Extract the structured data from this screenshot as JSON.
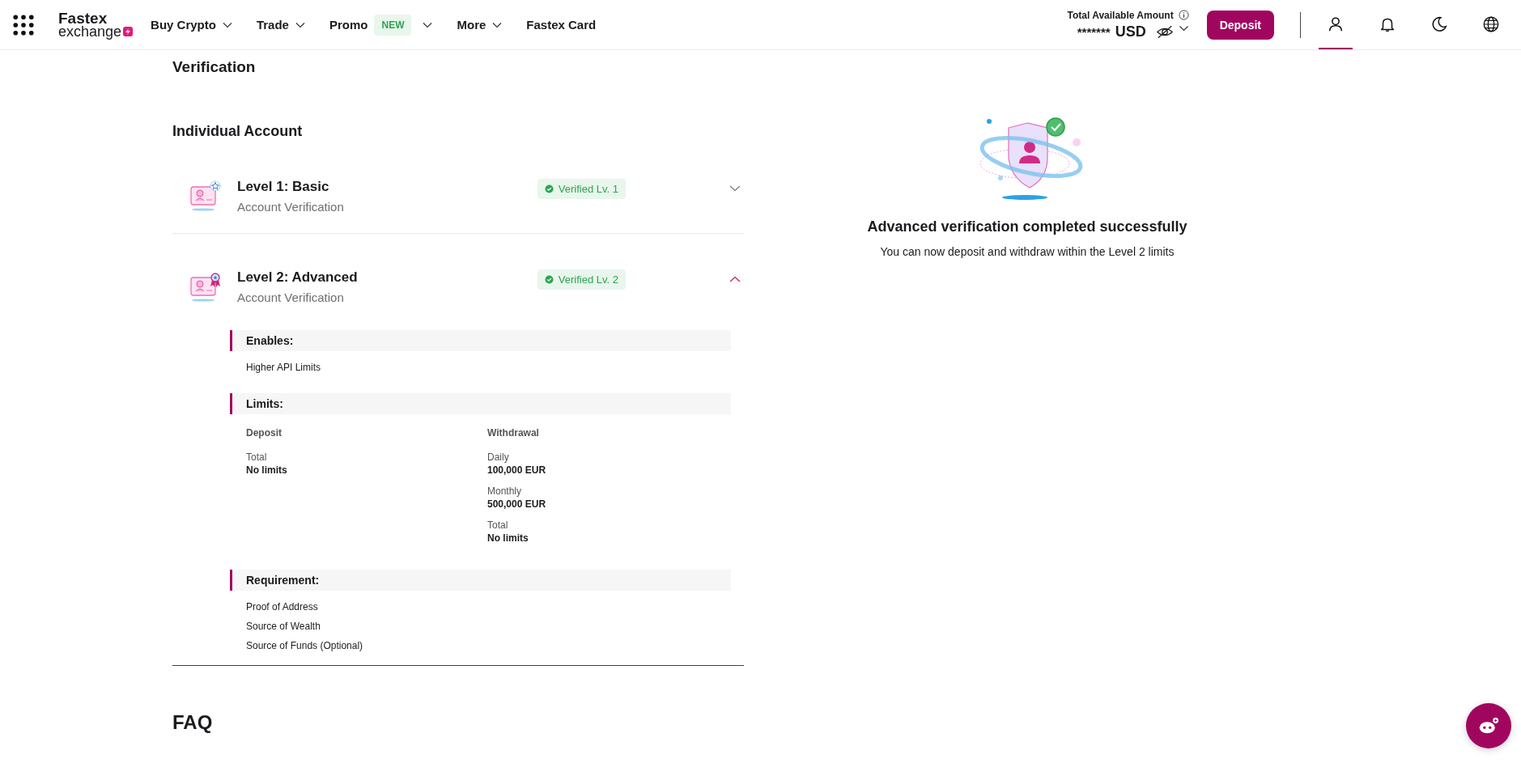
{
  "header": {
    "logo": {
      "line1": "Fastex",
      "line2": "exchange"
    },
    "nav": [
      {
        "label": "Buy Crypto",
        "caret": true
      },
      {
        "label": "Trade",
        "caret": true
      },
      {
        "label": "Promo",
        "caret": true,
        "badge": "NEW"
      },
      {
        "label": "More",
        "caret": true
      },
      {
        "label": "Fastex Card",
        "caret": false
      }
    ],
    "balance": {
      "label": "Total Available Amount",
      "amount": "*******",
      "currency": "USD"
    },
    "deposit": "Deposit",
    "icons": [
      {
        "kind": "profile",
        "selected": true
      },
      {
        "kind": "bell",
        "selected": false
      },
      {
        "kind": "moon",
        "selected": false
      },
      {
        "kind": "globe",
        "selected": false
      }
    ]
  },
  "page_title": "Verification",
  "section_title": "Individual Account",
  "levels": [
    {
      "title": "Level 1: Basic",
      "subtitle": "Account Verification",
      "badge": "Verified Lv. 1",
      "kind": "star",
      "expanded": false
    },
    {
      "title": "Level 2: Advanced",
      "subtitle": "Account Verification",
      "badge": "Verified Lv. 2",
      "kind": "medal",
      "expanded": true,
      "details": [
        {
          "kind": "list",
          "title": "Enables:",
          "items": [
            "Higher API Limits"
          ]
        },
        {
          "kind": "limits",
          "title": "Limits:",
          "columns": [
            {
              "heading": "Deposit",
              "entries": [
                {
                  "label": "Total",
                  "value": "No limits"
                }
              ]
            },
            {
              "heading": "Withdrawal",
              "entries": [
                {
                  "label": "Daily",
                  "value": "100,000 EUR"
                },
                {
                  "label": "Monthly",
                  "value": "500,000 EUR"
                },
                {
                  "label": "Total",
                  "value": "No limits"
                }
              ]
            }
          ]
        },
        {
          "kind": "list",
          "title": "Requirement:",
          "items": [
            "Proof of Address",
            "Source of Wealth",
            "Source of Funds (Optional)"
          ]
        }
      ]
    }
  ],
  "status": {
    "title": "Advanced verification completed successfully",
    "message": "You can now deposit and withdraw within the Level 2 limits"
  },
  "faq_title": "FAQ"
}
